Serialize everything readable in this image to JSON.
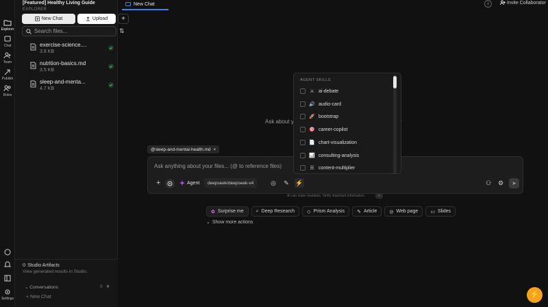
{
  "app": {
    "project_title": "[Featured] Healthy Living Guide",
    "panel_label": "EXPLORER"
  },
  "rail": {
    "top": [
      {
        "label": "Explorer",
        "icon": "folder-icon"
      },
      {
        "label": "Chat",
        "icon": "chat-icon"
      },
      {
        "label": "Team",
        "icon": "team-icon"
      },
      {
        "label": "Publish",
        "icon": "publish-icon"
      },
      {
        "label": "Roles",
        "icon": "roles-icon"
      }
    ],
    "bottom": [
      {
        "label": "",
        "icon": "message-icon"
      },
      {
        "label": "",
        "icon": "bell-icon"
      },
      {
        "label": "",
        "icon": "book-icon"
      },
      {
        "label": "Settings",
        "icon": "gear-icon"
      }
    ]
  },
  "explorer": {
    "new_chat_label": "New Chat",
    "upload_label": "Upload",
    "search_placeholder": "Search files...",
    "files": [
      {
        "name": "exercise-science....",
        "size": "3.8 KB"
      },
      {
        "name": "nutrition-basics.md",
        "size": "3.5 KB"
      },
      {
        "name": "sleep-and-menta...",
        "size": "4.7 KB"
      }
    ],
    "artifacts_title": "Studio Artifacts",
    "artifacts_subtitle": "View generated results in Studio.",
    "conversations_label": "Conversations",
    "conversations_count": "0",
    "new_chat_item": "New Chat"
  },
  "topbar": {
    "tab_label": "New Chat",
    "invite_label": "Invite Collaborator"
  },
  "main": {
    "greeting_start": "Ask about y",
    "greeting_end": "r",
    "reference_chip": "@sleep-and-mental-health.md",
    "input_placeholder": "Ask anything about your files... (@ to reference files)",
    "agent_label": "Agent",
    "model_label": "deepseek/deepseek-v4",
    "disclaimer": "AI can make mistakes. Verify important information.",
    "actions": [
      {
        "label": "Surprise me",
        "icon": "sparkle-icon"
      },
      {
        "label": "Deep Research",
        "icon": "research-icon"
      },
      {
        "label": "Prism Analysis",
        "icon": "prism-icon"
      },
      {
        "label": "Article",
        "icon": "pen-icon"
      },
      {
        "label": "Web page",
        "icon": "globe-icon"
      },
      {
        "label": "Slides",
        "icon": "slides-icon"
      }
    ],
    "more_actions": "Show more actions"
  },
  "skills": {
    "header": "AGENT SKILLS",
    "items": [
      {
        "label": "ai-debate",
        "emoji": "⚔"
      },
      {
        "label": "audio-card",
        "emoji": "🔊"
      },
      {
        "label": "bootstrap",
        "emoji": "🚀"
      },
      {
        "label": "career-copilot",
        "emoji": "🎯"
      },
      {
        "label": "chart-visualization",
        "emoji": "📄"
      },
      {
        "label": "consulting-analysis",
        "emoji": "📊"
      },
      {
        "label": "content-multiplier",
        "emoji": "☰"
      }
    ]
  },
  "colors": {
    "accent": "#3b82f6",
    "fab": "#f5a31a",
    "agent": "#a855f7",
    "ok": "#22c55e"
  }
}
